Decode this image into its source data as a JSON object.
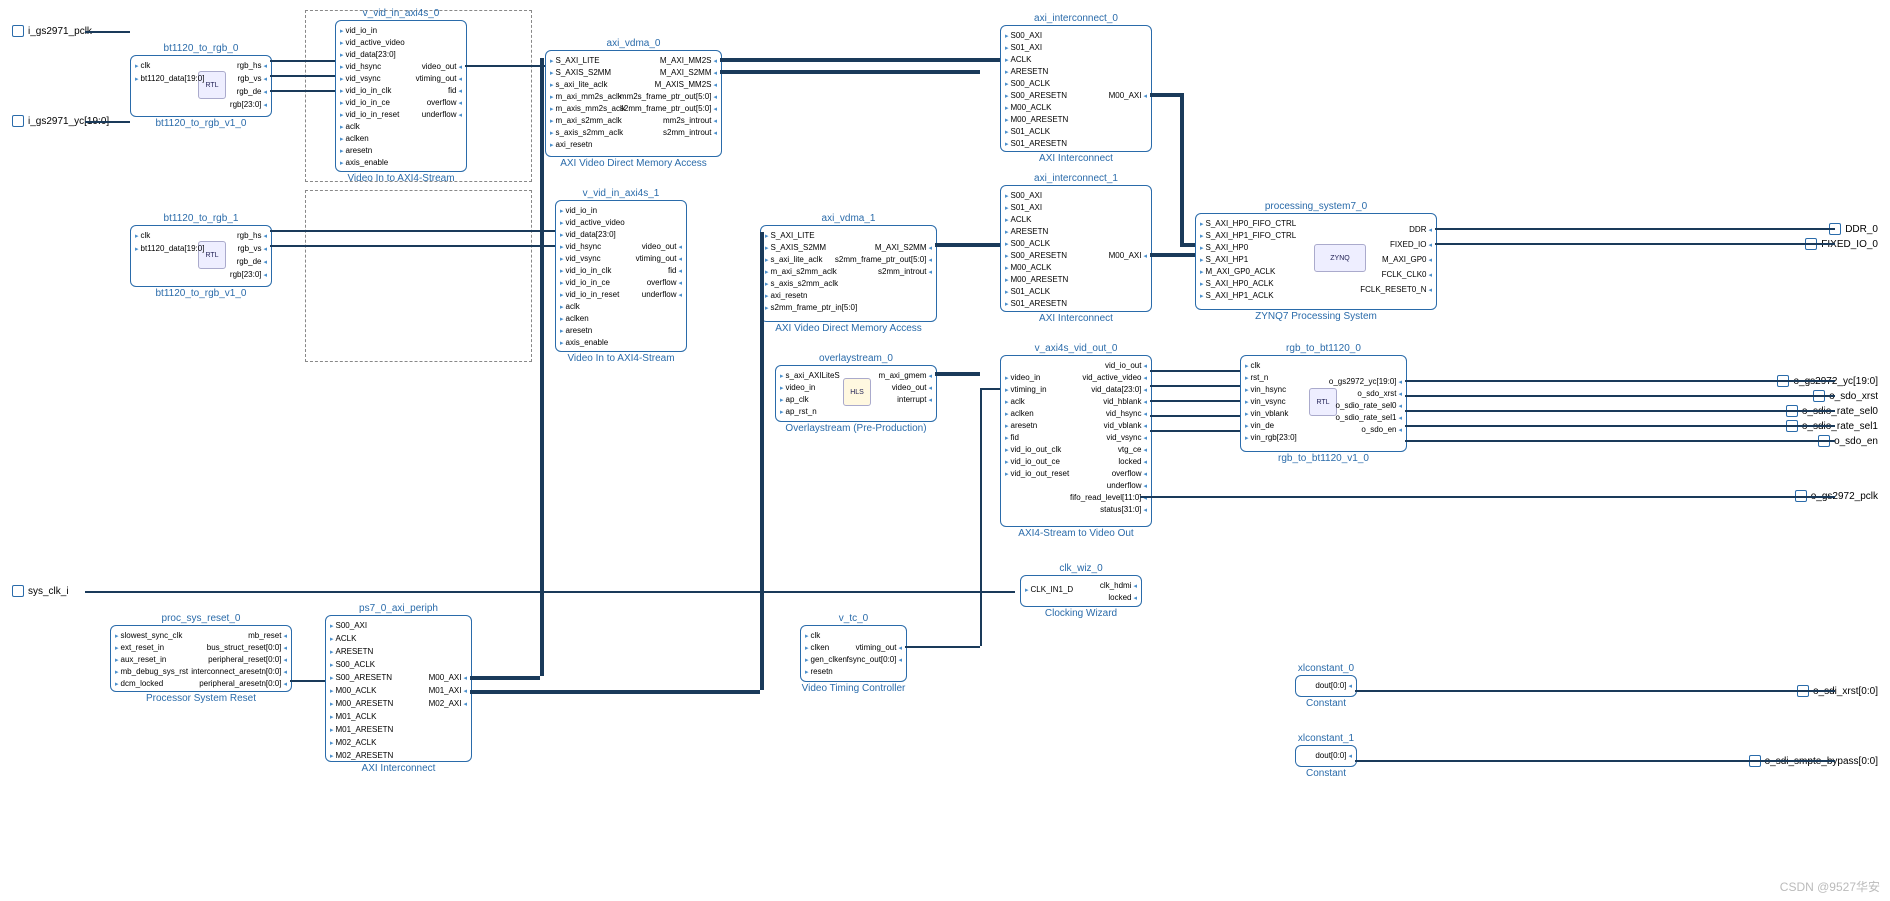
{
  "diagram": {
    "watermark": "CSDN @9527华安"
  },
  "external_ports": {
    "left": [
      {
        "label": "i_gs2971_pclk"
      },
      {
        "label": "i_gs2971_yc[19:0]"
      },
      {
        "label": "sys_clk_i"
      }
    ],
    "right": [
      {
        "label": "DDR_0"
      },
      {
        "label": "FIXED_IO_0"
      },
      {
        "label": "o_gs2972_yc[19:0]"
      },
      {
        "label": "o_sdo_xrst"
      },
      {
        "label": "o_sdio_rate_sel0"
      },
      {
        "label": "o_sdio_rate_sel1"
      },
      {
        "label": "o_sdo_en"
      },
      {
        "label": "o_gs2972_pclk"
      },
      {
        "label": "o_sdi_xrst[0:0]"
      },
      {
        "label": "o_sdi_smpte_bypass[0:0]"
      }
    ]
  },
  "blocks": {
    "bt1120_0": {
      "instance": "bt1120_to_rgb_0",
      "caption": "bt1120_to_rgb_v1_0",
      "icon": "RTL",
      "ports_l": [
        "clk",
        "bt1120_data[19:0]"
      ],
      "ports_r": [
        "rgb_hs",
        "rgb_vs",
        "rgb_de",
        "rgb[23:0]"
      ]
    },
    "bt1120_1": {
      "instance": "bt1120_to_rgb_1",
      "caption": "bt1120_to_rgb_v1_0",
      "icon": "RTL",
      "ports_l": [
        "clk",
        "bt1120_data[19:0]"
      ],
      "ports_r": [
        "rgb_hs",
        "rgb_vs",
        "rgb_de",
        "rgb[23:0]"
      ]
    },
    "vid_in_0": {
      "instance": "v_vid_in_axi4s_0",
      "caption": "Video In to AXI4-Stream",
      "ports_l": [
        "vid_io_in",
        "vid_active_video",
        "vid_data[23:0]",
        "vid_hsync",
        "vid_vsync",
        "vid_io_in_clk",
        "vid_io_in_ce",
        "vid_io_in_reset",
        "aclk",
        "aclken",
        "aresetn",
        "axis_enable"
      ],
      "ports_r": [
        "video_out",
        "vtiming_out",
        "fid",
        "overflow",
        "underflow"
      ]
    },
    "vid_in_1": {
      "instance": "v_vid_in_axi4s_1",
      "caption": "Video In to AXI4-Stream",
      "ports_l": [
        "vid_io_in",
        "vid_active_video",
        "vid_data[23:0]",
        "vid_hsync",
        "vid_vsync",
        "vid_io_in_clk",
        "vid_io_in_ce",
        "vid_io_in_reset",
        "aclk",
        "aclken",
        "aresetn",
        "axis_enable"
      ],
      "ports_r": [
        "video_out",
        "vtiming_out",
        "fid",
        "overflow",
        "underflow"
      ]
    },
    "vdma_0": {
      "instance": "axi_vdma_0",
      "caption": "AXI Video Direct Memory Access",
      "ports_l": [
        "S_AXI_LITE",
        "S_AXIS_S2MM",
        "s_axi_lite_aclk",
        "m_axi_mm2s_aclk",
        "m_axis_mm2s_aclk",
        "m_axi_s2mm_aclk",
        "s_axis_s2mm_aclk",
        "axi_resetn"
      ],
      "ports_r": [
        "M_AXI_MM2S",
        "M_AXI_S2MM",
        "M_AXIS_MM2S",
        "mm2s_frame_ptr_out[5:0]",
        "s2mm_frame_ptr_out[5:0]",
        "mm2s_introut",
        "s2mm_introut"
      ]
    },
    "vdma_1": {
      "instance": "axi_vdma_1",
      "caption": "AXI Video Direct Memory Access",
      "ports_l": [
        "S_AXI_LITE",
        "S_AXIS_S2MM",
        "s_axi_lite_aclk",
        "m_axi_s2mm_aclk",
        "s_axis_s2mm_aclk",
        "axi_resetn",
        "s2mm_frame_ptr_in[5:0]"
      ],
      "ports_r": [
        "M_AXI_S2MM",
        "s2mm_frame_ptr_out[5:0]",
        "s2mm_introut"
      ]
    },
    "overlay": {
      "instance": "overlaystream_0",
      "caption": "Overlaystream (Pre-Production)",
      "icon": "HLS",
      "ports_l": [
        "s_axi_AXILiteS",
        "video_in",
        "ap_clk",
        "ap_rst_n"
      ],
      "ports_r": [
        "m_axi_gmem",
        "video_out",
        "interrupt"
      ]
    },
    "ic_0": {
      "instance": "axi_interconnect_0",
      "caption": "AXI Interconnect",
      "ports_l": [
        "S00_AXI",
        "S01_AXI",
        "ACLK",
        "ARESETN",
        "S00_ACLK",
        "S00_ARESETN",
        "M00_ACLK",
        "M00_ARESETN",
        "S01_ACLK",
        "S01_ARESETN"
      ],
      "ports_r": [
        "M00_AXI"
      ]
    },
    "ic_1": {
      "instance": "axi_interconnect_1",
      "caption": "AXI Interconnect",
      "ports_l": [
        "S00_AXI",
        "S01_AXI",
        "ACLK",
        "ARESETN",
        "S00_ACLK",
        "S00_ARESETN",
        "M00_ACLK",
        "M00_ARESETN",
        "S01_ACLK",
        "S01_ARESETN"
      ],
      "ports_r": [
        "M00_AXI"
      ]
    },
    "ps7": {
      "instance": "processing_system7_0",
      "caption": "ZYNQ7 Processing System",
      "icon": "ZYNQ",
      "ports_l": [
        "S_AXI_HP0_FIFO_CTRL",
        "S_AXI_HP1_FIFO_CTRL",
        "S_AXI_HP0",
        "S_AXI_HP1",
        "M_AXI_GP0_ACLK",
        "S_AXI_HP0_ACLK",
        "S_AXI_HP1_ACLK"
      ],
      "ports_r": [
        "DDR",
        "FIXED_IO",
        "M_AXI_GP0",
        "FCLK_CLK0",
        "FCLK_RESET0_N"
      ]
    },
    "vid_out": {
      "instance": "v_axi4s_vid_out_0",
      "caption": "AXI4-Stream to Video Out",
      "ports_l": [
        "video_in",
        "vtiming_in",
        "aclk",
        "aclken",
        "aresetn",
        "fid",
        "vid_io_out_clk",
        "vid_io_out_ce",
        "vid_io_out_reset"
      ],
      "ports_r": [
        "vid_io_out",
        "vid_active_video",
        "vid_data[23:0]",
        "vid_hblank",
        "vid_hsync",
        "vid_vblank",
        "vid_vsync",
        "vtg_ce",
        "locked",
        "overflow",
        "underflow",
        "fifo_read_level[11:0]",
        "status[31:0]"
      ]
    },
    "rgb_out": {
      "instance": "rgb_to_bt1120_0",
      "caption": "rgb_to_bt1120_v1_0",
      "icon": "RTL",
      "ports_l": [
        "clk",
        "rst_n",
        "vin_hsync",
        "vin_vsync",
        "vin_vblank",
        "vin_de",
        "vin_rgb[23:0]"
      ],
      "ports_r": [
        "o_gs2972_yc[19:0]",
        "o_sdo_xrst",
        "o_sdio_rate_sel0",
        "o_sdio_rate_sel1",
        "o_sdo_en"
      ]
    },
    "clk_wiz": {
      "instance": "clk_wiz_0",
      "caption": "Clocking Wizard",
      "ports_l": [
        "CLK_IN1_D"
      ],
      "ports_r": [
        "clk_hdmi",
        "locked"
      ]
    },
    "psr": {
      "instance": "proc_sys_reset_0",
      "caption": "Processor System Reset",
      "ports_l": [
        "slowest_sync_clk",
        "ext_reset_in",
        "aux_reset_in",
        "mb_debug_sys_rst",
        "dcm_locked"
      ],
      "ports_r": [
        "mb_reset",
        "bus_struct_reset[0:0]",
        "peripheral_reset[0:0]",
        "interconnect_aresetn[0:0]",
        "peripheral_aresetn[0:0]"
      ]
    },
    "ps7_periph": {
      "instance": "ps7_0_axi_periph",
      "caption": "AXI Interconnect",
      "ports_l": [
        "S00_AXI",
        "ACLK",
        "ARESETN",
        "S00_ACLK",
        "S00_ARESETN",
        "M00_ACLK",
        "M00_ARESETN",
        "M01_ACLK",
        "M01_ARESETN",
        "M02_ACLK",
        "M02_ARESETN"
      ],
      "ports_r": [
        "M00_AXI",
        "M01_AXI",
        "M02_AXI"
      ]
    },
    "vtc": {
      "instance": "v_tc_0",
      "caption": "Video Timing Controller",
      "ports_l": [
        "clk",
        "clken",
        "gen_clken",
        "resetn"
      ],
      "ports_r": [
        "vtiming_out",
        "fsync_out[0:0]"
      ]
    },
    "xlc0": {
      "instance": "xlconstant_0",
      "caption": "Constant",
      "ports_r": [
        "dout[0:0]"
      ]
    },
    "xlc1": {
      "instance": "xlconstant_1",
      "caption": "Constant",
      "ports_r": [
        "dout[0:0]"
      ]
    }
  }
}
